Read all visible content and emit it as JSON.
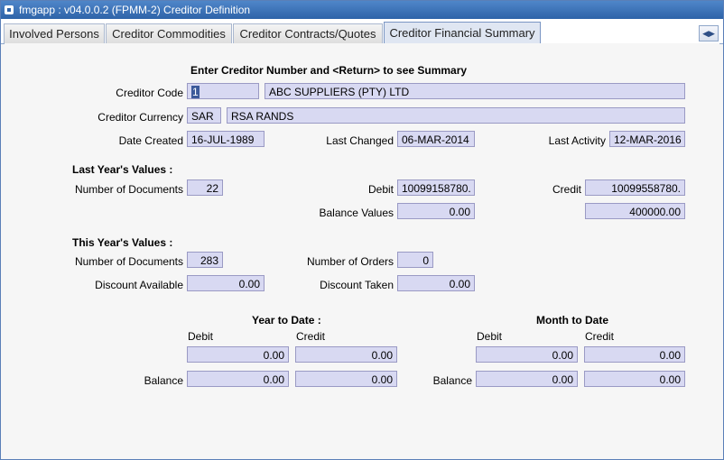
{
  "window": {
    "title": "fmgapp : v04.0.0.2  (FPMM-2) Creditor Definition"
  },
  "tabs": [
    {
      "label": "Involved Persons"
    },
    {
      "label": "Creditor Commodities"
    },
    {
      "label": "Creditor Contracts/Quotes"
    },
    {
      "label": "Creditor Financial Summary",
      "active": true
    }
  ],
  "tab_scroll_glyph": "◀▶",
  "form": {
    "heading": "Enter Creditor Number and <Return> to see Summary",
    "creditor_code": {
      "label": "Creditor Code",
      "value": "1",
      "name": "ABC SUPPLIERS (PTY) LTD"
    },
    "creditor_currency": {
      "label": "Creditor Currency",
      "code": "SAR",
      "name": "RSA RANDS"
    },
    "date_created": {
      "label": "Date Created",
      "value": "16-JUL-1989"
    },
    "last_changed": {
      "label": "Last Changed",
      "value": "06-MAR-2014"
    },
    "last_activity": {
      "label": "Last Activity",
      "value": "12-MAR-2016"
    },
    "last_year": {
      "heading": "Last Year's Values :",
      "num_documents_label": "Number of Documents",
      "num_documents": "22",
      "debit_label": "Debit",
      "debit": "10099158780.",
      "credit_label": "Credit",
      "credit": "10099558780.",
      "balance_label": "Balance Values",
      "balance_debit": "0.00",
      "balance_credit": "400000.00"
    },
    "this_year": {
      "heading": "This Year's Values :",
      "num_documents_label": "Number of Documents",
      "num_documents": "283",
      "num_orders_label": "Number of Orders",
      "num_orders": "0",
      "discount_available_label": "Discount Available",
      "discount_available": "0.00",
      "discount_taken_label": "Discount Taken",
      "discount_taken": "0.00"
    },
    "year_to_date": {
      "heading": "Year to Date :",
      "debit_label": "Debit",
      "credit_label": "Credit",
      "debit": "0.00",
      "credit": "0.00",
      "balance_label": "Balance",
      "balance_debit": "0.00",
      "balance_credit": "0.00"
    },
    "month_to_date": {
      "heading": "Month to Date",
      "debit_label": "Debit",
      "credit_label": "Credit",
      "debit": "0.00",
      "credit": "0.00",
      "balance_label": "Balance",
      "balance_debit": "0.00",
      "balance_credit": "0.00"
    }
  }
}
